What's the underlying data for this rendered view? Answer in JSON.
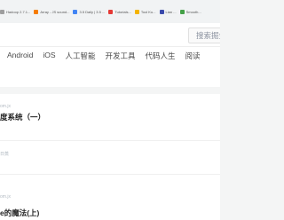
{
  "bookmarks": [
    {
      "label": "Hadoop 2.7.1...",
      "icon_color": "#9e9e9e"
    },
    {
      "label": "Array - JS sound...",
      "icon_color": "#f57c00"
    },
    {
      "label": "3.5 Daily | 3.5 ...",
      "icon_color": "#4285f4"
    },
    {
      "label": "Tutorials...",
      "icon_color": "#e53935"
    },
    {
      "label": "Tool Ku...",
      "icon_color": "#f4b400"
    },
    {
      "label": "Lian ...",
      "icon_color": "#3949ab"
    },
    {
      "label": "Smooth...",
      "icon_color": "#43a047"
    }
  ],
  "header": {
    "search_placeholder": "搜索掘金"
  },
  "nav": {
    "items": [
      "Android",
      "iOS",
      "人工智能",
      "开发工具",
      "代码人生",
      "阅读"
    ]
  },
  "articles": [
    {
      "meta": "om.jx",
      "title": "度系统（一）"
    },
    {
      "meta": "日蒸",
      "title": ""
    },
    {
      "meta": "om.jx",
      "title": "e的魔法(上)"
    }
  ]
}
